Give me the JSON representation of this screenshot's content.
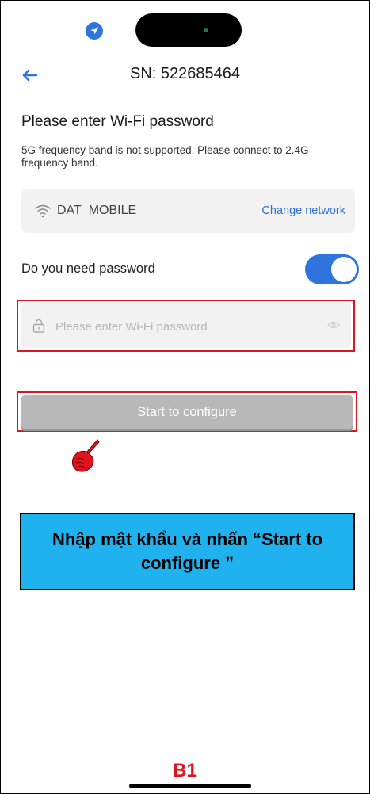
{
  "header": {
    "title": "SN: 522685464"
  },
  "content": {
    "heading": "Please enter Wi-Fi password",
    "notice": "5G frequency band is not supported. Please connect to 2.4G frequency band."
  },
  "network": {
    "ssid": "DAT_MOBILE",
    "change_label": "Change network"
  },
  "password": {
    "toggle_label": "Do you need password",
    "toggle_on": true,
    "placeholder": "Please enter Wi-Fi password",
    "value": ""
  },
  "actions": {
    "start_label": "Start to configure"
  },
  "annotation": {
    "instruction": "Nhập mật khẩu và nhấn “Start to configure ”",
    "step": "B1"
  },
  "colors": {
    "accent": "#2f73dc",
    "link": "#2f6fd6",
    "highlight": "#e0141e",
    "callout_bg": "#1fb2ee",
    "button_disabled": "#b8b8b8"
  },
  "icons": {
    "status": "location-arrow-icon",
    "back": "arrow-left-icon",
    "network": "wifi-icon",
    "field": "lock-icon",
    "visibility": "eye-icon",
    "pointer": "pointing-hand-icon"
  }
}
